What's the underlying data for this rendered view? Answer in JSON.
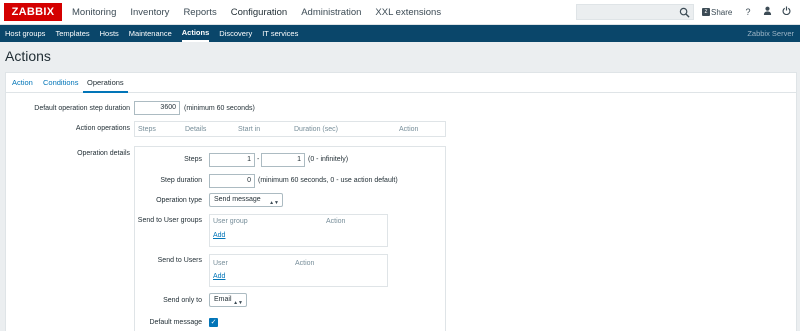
{
  "app": {
    "logo": "ZABBIX",
    "server_name": "Zabbix Server"
  },
  "main_menu": [
    "Monitoring",
    "Inventory",
    "Reports",
    "Configuration",
    "Administration",
    "XXL extensions"
  ],
  "topbar": {
    "share_label": "Share",
    "help": "?",
    "user": "♣",
    "logout": "⏻"
  },
  "sub_menu": [
    "Host groups",
    "Templates",
    "Hosts",
    "Maintenance",
    "Actions",
    "Discovery",
    "IT services"
  ],
  "page": {
    "title": "Actions"
  },
  "tabs": [
    "Action",
    "Conditions",
    "Operations"
  ],
  "form": {
    "default_step_duration_label": "Default operation step duration",
    "default_step_duration_value": "3600",
    "default_step_duration_hint": "(minimum 60 seconds)",
    "action_operations_label": "Action operations",
    "action_operations_columns": [
      "Steps",
      "Details",
      "Start in",
      "Duration (sec)",
      "Action"
    ],
    "operation_details_label": "Operation details",
    "steps_label": "Steps",
    "steps_from": "1",
    "steps_dash": "-",
    "steps_to": "1",
    "steps_hint": "(0 - infinitely)",
    "step_duration_label": "Step duration",
    "step_duration_value": "0",
    "step_duration_hint": "(minimum 60 seconds, 0 - use action default)",
    "operation_type_label": "Operation type",
    "operation_type_value": "Send message",
    "send_to_groups_label": "Send to User groups",
    "groups_columns": [
      "User group",
      "Action"
    ],
    "groups_add": "Add",
    "send_to_users_label": "Send to Users",
    "users_columns": [
      "User",
      "Action"
    ],
    "users_add": "Add",
    "send_only_to_label": "Send only to",
    "send_only_to_value": "Email",
    "default_message_label": "Default message"
  },
  "colors": {
    "brand": "#d40000",
    "subnav": "#0a466a",
    "link": "#0275b8"
  }
}
